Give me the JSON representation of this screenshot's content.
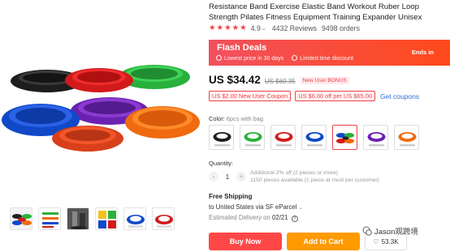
{
  "product": {
    "title": "Resistance Band Exercise Elastic Band Workout Ruber Loop Strength Pilates Fitness Equipment Training Expander Unisex",
    "rating": "4.9",
    "reviews": "4432 Reviews",
    "orders": "9498 orders"
  },
  "flash": {
    "title": "Flash Deals",
    "lowest": "Lowest price in 30 days",
    "limited": "Limited time discount",
    "ends": "Ends in"
  },
  "price": {
    "current": "US $34.42",
    "original": "US $60.35",
    "badge": "New User BONUS"
  },
  "coupons": {
    "items": [
      "US $2.00 New User Coupon",
      "US $6.00 off per US $65.00"
    ],
    "link": "Get coupons"
  },
  "color": {
    "label": "Color:",
    "selected": "6pcs with bag",
    "selected_index": 4,
    "swatches": [
      "black",
      "green",
      "red",
      "blue",
      "mixed",
      "purple",
      "orange"
    ]
  },
  "quantity": {
    "label": "Quantity:",
    "value": "1",
    "minus": "-",
    "plus": "+",
    "discount": "Additional 2% off (2 pieces or more)",
    "available": "1150 pieces available (1 piece at most per customer)"
  },
  "shipping": {
    "title": "Free Shipping",
    "to": "to United States via SF eParcel",
    "delivery_label": "Estimated Delivery on",
    "delivery_date": "02/21"
  },
  "actions": {
    "buy": "Buy Now",
    "cart": "Add to Cart",
    "wish_count": "53.3K"
  },
  "watermark": {
    "text": "Jason观跨境"
  },
  "colors": {
    "accent": "#ff4747",
    "cart": "#ff9a00",
    "link": "#2a6fd6"
  }
}
